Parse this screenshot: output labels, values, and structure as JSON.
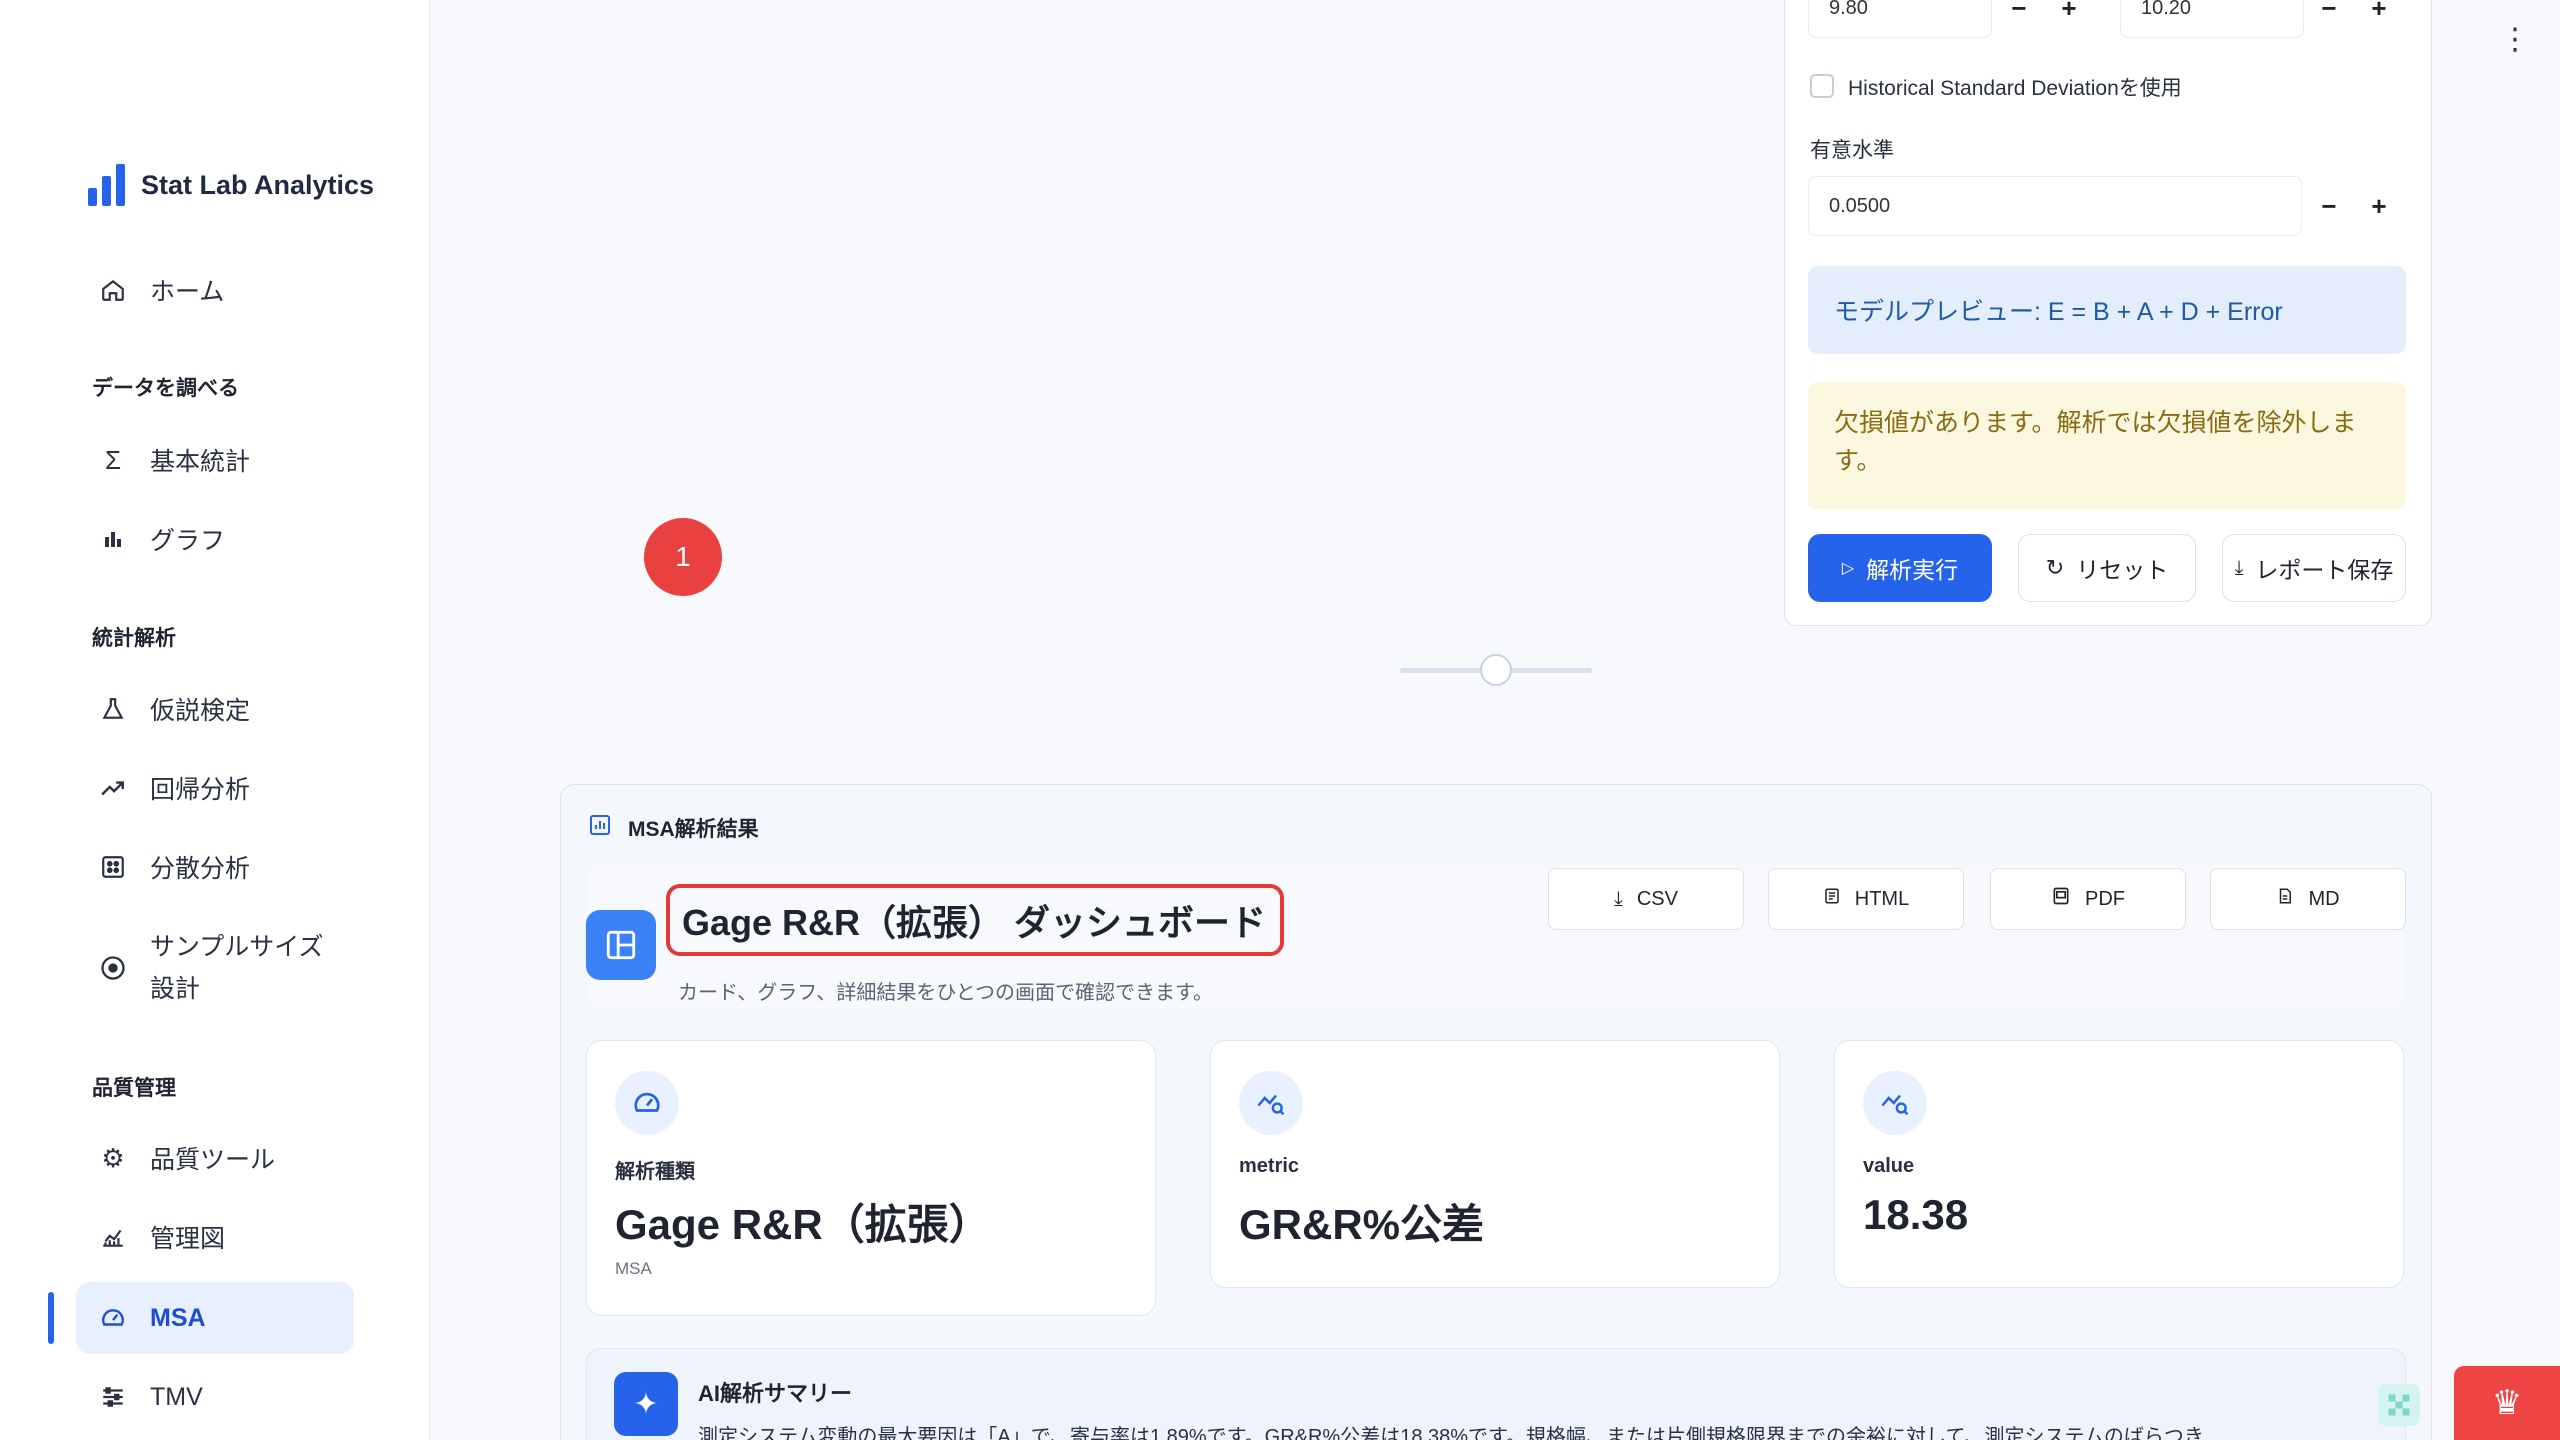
{
  "brand": {
    "name": "Stat Lab Analytics"
  },
  "sidebar": {
    "home": "ホーム",
    "section_explore": "データを調べる",
    "basic_stats": "基本統計",
    "graph": "グラフ",
    "section_stats": "統計解析",
    "hypothesis": "仮説検定",
    "regression": "回帰分析",
    "anova": "分散分析",
    "sample_size_1": "サンプルサイズ",
    "sample_size_2": "設計",
    "section_quality": "品質管理",
    "quality_tools": "品質ツール",
    "control_chart": "管理図",
    "msa": "MSA",
    "tmv": "TMV"
  },
  "form": {
    "lsl_value": "9.80",
    "usl_value": "10.20",
    "historical_sd_label": "Historical Standard Deviationを使用",
    "alpha_label": "有意水準",
    "alpha_value": "0.0500",
    "model_preview": "モデルプレビュー: E = B + A + D + Error",
    "missing_warning": "欠損値があります。解析では欠損値を除外します。",
    "run_button": "解析実行",
    "reset_button": "リセット",
    "save_report_button": "レポート保存",
    "minus": "−",
    "plus": "+"
  },
  "step_badge": "1",
  "results": {
    "header": "MSA解析結果",
    "dashboard_title": "Gage R&R（拡張） ダッシュボード",
    "dashboard_subtitle": "カード、グラフ、詳細結果をひとつの画面で確認できます。",
    "export": {
      "csv": "CSV",
      "html": "HTML",
      "pdf": "PDF",
      "md": "MD"
    },
    "cards": [
      {
        "label": "解析種類",
        "value": "Gage R&R（拡張）",
        "sub": "MSA"
      },
      {
        "label": "metric",
        "value": "GR&R%公差"
      },
      {
        "label": "value",
        "value": "18.38"
      }
    ],
    "ai_title": "AI解析サマリー",
    "ai_text": "測定システム変動の最大要因は「A」で、寄与率は1.89%です。GR&R%公差は18.38%です。規格幅、または片側規格限界までの余裕に対して、測定システムのばらつき"
  },
  "colors": {
    "accent": "#2563eb",
    "highlight": "#e53935",
    "badge": "#e94040"
  }
}
